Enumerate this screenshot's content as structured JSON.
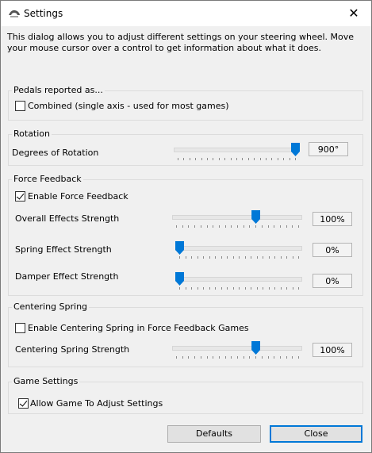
{
  "window": {
    "title": "Settings",
    "close_glyph": "✕",
    "icon": "steering-wheel-app-icon"
  },
  "intro_text": "This dialog allows you to adjust different settings on your steering wheel.  Move your mouse cursor over a control to get information about what it does.",
  "pedals": {
    "legend": "Pedals reported as...",
    "combined_label": "Combined (single axis - used for most games)",
    "combined_checked": false
  },
  "rotation": {
    "legend": "Rotation",
    "degrees_label": "Degrees of Rotation",
    "degrees_value": "900°",
    "degrees_fraction": 1.0
  },
  "force_feedback": {
    "legend": "Force Feedback",
    "enable_label": "Enable Force Feedback",
    "enable_checked": true,
    "overall_label": "Overall Effects Strength",
    "overall_value": "100%",
    "overall_fraction": 0.65,
    "spring_label": "Spring Effect Strength",
    "spring_value": "0%",
    "spring_fraction": 0.0,
    "damper_label": "Damper Effect Strength",
    "damper_value": "0%",
    "damper_fraction": 0.0
  },
  "centering_spring": {
    "legend": "Centering Spring",
    "enable_label": "Enable Centering Spring in Force Feedback Games",
    "enable_checked": false,
    "strength_label": "Centering Spring Strength",
    "strength_value": "100%",
    "strength_fraction": 0.65
  },
  "game_settings": {
    "legend": "Game Settings",
    "allow_label": "Allow Game To Adjust Settings",
    "allow_checked": true
  },
  "buttons": {
    "defaults": "Defaults",
    "close": "Close"
  },
  "colors": {
    "accent": "#0078d7",
    "title_bg": "#ffffff",
    "dialog_bg": "#f0f0f0"
  }
}
